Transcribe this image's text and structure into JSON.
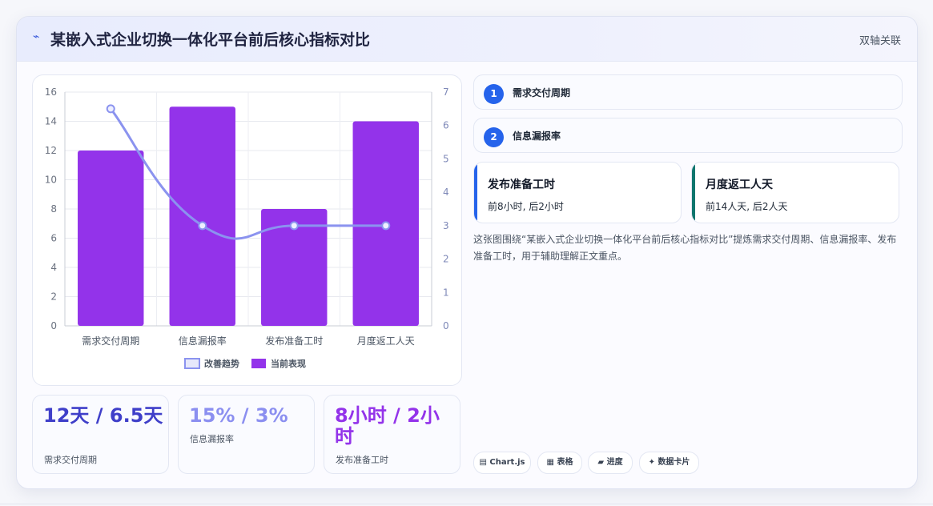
{
  "header": {
    "title": "某嵌入式企业切换一体化平台前后核心指标对比",
    "tag": "双轴关联",
    "icon": "lightning-icon"
  },
  "chart_data": {
    "type": "bar",
    "categories": [
      "需求交付周期",
      "信息漏报率",
      "发布准备工时",
      "月度返工人天"
    ],
    "series": [
      {
        "name": "当前表现",
        "type": "bar",
        "axis": "left",
        "values": [
          12,
          15,
          8,
          14
        ],
        "color": "#9333ea"
      },
      {
        "name": "改善趋势",
        "type": "line",
        "axis": "right",
        "values": [
          6.5,
          3,
          3,
          3
        ],
        "color": "#8b93ef"
      }
    ],
    "y_left": {
      "ticks": [
        0,
        2,
        4,
        6,
        8,
        10,
        12,
        14,
        16
      ],
      "ylim": [
        0,
        16
      ]
    },
    "y_right": {
      "ticks": [
        0,
        1,
        2,
        3,
        4,
        5,
        6,
        7
      ],
      "ylim": [
        0,
        7
      ]
    },
    "grid": true,
    "legend": {
      "position": "bottom",
      "items": [
        "改善趋势",
        "当前表现"
      ]
    }
  },
  "stats": [
    {
      "value": "12天 / 6.5天",
      "label": "需求交付周期",
      "color": "#3f3fc9"
    },
    {
      "value": "15% / 3%",
      "label": "信息漏报率",
      "color": "#8b8ff0"
    },
    {
      "value": "8小时 / 2小时",
      "label": "发布准备工时",
      "color": "#9333ea"
    }
  ],
  "steps": [
    {
      "num": "1",
      "label": "需求交付周期"
    },
    {
      "num": "2",
      "label": "信息漏报率"
    }
  ],
  "kcards": [
    {
      "title": "发布准备工时",
      "sub": "前8小时, 后2小时",
      "accent": "#2563eb"
    },
    {
      "title": "月度返工人天",
      "sub": "前14人天, 后2人天",
      "accent": "#0f766e"
    }
  ],
  "description": "这张图围绕“某嵌入式企业切换一体化平台前后核心指标对比”提炼需求交付周期、信息漏报率、发布准备工时，用于辅助理解正文重点。",
  "chips": [
    {
      "label": "Chart.js",
      "icon": "chart-icon"
    },
    {
      "label": "表格",
      "icon": "table-icon"
    },
    {
      "label": "进度",
      "icon": "progress-icon"
    },
    {
      "label": "数据卡片",
      "icon": "sparkle-icon"
    }
  ]
}
